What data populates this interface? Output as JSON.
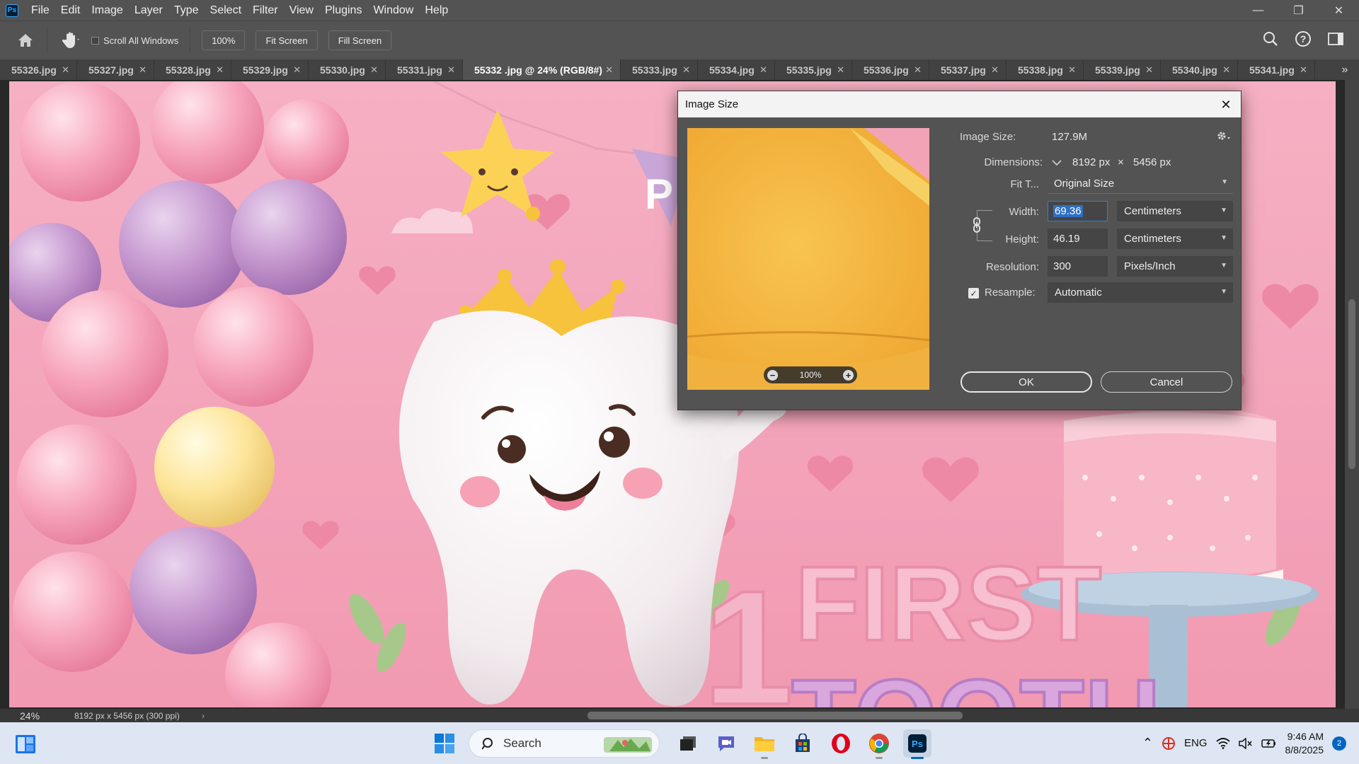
{
  "menu": [
    "File",
    "Edit",
    "Image",
    "Layer",
    "Type",
    "Select",
    "Filter",
    "View",
    "Plugins",
    "Window",
    "Help"
  ],
  "options": {
    "scroll_all_windows": "Scroll All Windows",
    "zoom_100": "100%",
    "fit_screen": "Fit Screen",
    "fill_screen": "Fill Screen"
  },
  "tabs": [
    {
      "label": "55326.jpg"
    },
    {
      "label": "55327.jpg"
    },
    {
      "label": "55328.jpg"
    },
    {
      "label": "55329.jpg"
    },
    {
      "label": "55330.jpg"
    },
    {
      "label": "55331.jpg"
    },
    {
      "label": "55332 .jpg @ 24% (RGB/8#)",
      "active": true
    },
    {
      "label": "55333.jpg"
    },
    {
      "label": "55334.jpg"
    },
    {
      "label": "55335.jpg"
    },
    {
      "label": "55336.jpg"
    },
    {
      "label": "55337.jpg"
    },
    {
      "label": "55338.jpg"
    },
    {
      "label": "55339.jpg"
    },
    {
      "label": "55340.jpg"
    },
    {
      "label": "55341.jpg"
    }
  ],
  "tab_close": "✕",
  "canvas": {
    "number": "1",
    "headline_line1": "FIRST",
    "headline_line2": "TOOTH"
  },
  "status": {
    "zoom": "24%",
    "doc_info": "8192 px x 5456 px (300 ppi)",
    "chevron": "›"
  },
  "dialog": {
    "title": "Image Size",
    "image_size_label": "Image Size:",
    "image_size_value": "127.9M",
    "dimensions_label": "Dimensions:",
    "dim_width": "8192 px",
    "dim_x": "×",
    "dim_height": "5456 px",
    "fit_to_label": "Fit T...",
    "fit_to_value": "Original Size",
    "width_label": "Width:",
    "width_value": "69.36",
    "width_unit": "Centimeters",
    "height_label": "Height:",
    "height_value": "46.19",
    "height_unit": "Centimeters",
    "resolution_label": "Resolution:",
    "resolution_value": "300",
    "resolution_unit": "Pixels/Inch",
    "resample_label": "Resample:",
    "resample_value": "Automatic",
    "preview_zoom": "100%",
    "ok": "OK",
    "cancel": "Cancel"
  },
  "taskbar": {
    "search_label": "Search",
    "language": "ENG",
    "time": "9:46 AM",
    "date": "8/8/2025",
    "notifications": "2"
  },
  "colors": {
    "accent": "#31a8ff",
    "windows_blue": "#0067c0",
    "opera_red": "#e0001b",
    "canvas_pink": "#f4a8bd"
  }
}
